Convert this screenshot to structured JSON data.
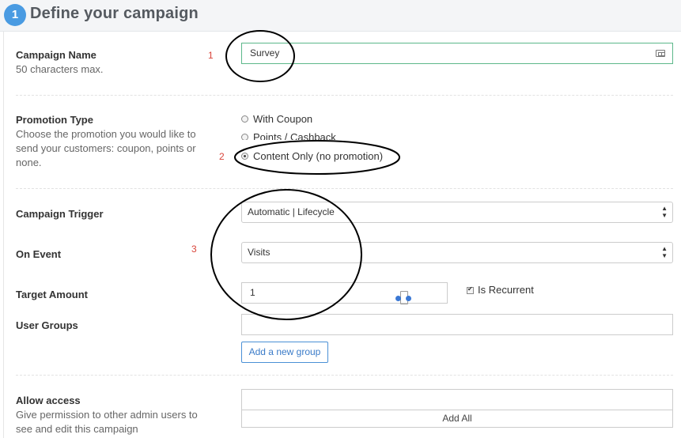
{
  "header": {
    "step_number": "1",
    "title": "Define your campaign"
  },
  "campaign_name": {
    "label": "Campaign Name",
    "hint": "50 characters max.",
    "value": "Survey",
    "icon": "id-card-icon",
    "annotation": "1"
  },
  "promotion_type": {
    "label": "Promotion Type",
    "description_lines": [
      "Choose the promotion you would like to",
      "send your customers: coupon, points or",
      "none."
    ],
    "options": [
      {
        "label": "With Coupon",
        "checked": false
      },
      {
        "label": "Points / Cashback",
        "checked": false
      },
      {
        "label": "Content Only (no promotion)",
        "checked": true
      }
    ],
    "annotation": "2"
  },
  "campaign_trigger": {
    "label": "Campaign Trigger",
    "selected": "Automatic | Lifecycle"
  },
  "on_event": {
    "label": "On Event",
    "selected": "Visits",
    "annotation": "3"
  },
  "target_amount": {
    "label": "Target Amount",
    "value": "1",
    "recurrent_label": "Is Recurrent",
    "recurrent_checked": true
  },
  "user_groups": {
    "label": "User Groups",
    "value": "",
    "add_button": "Add a new group"
  },
  "allow_access": {
    "label": "Allow access",
    "description_lines": [
      "Give permission to other admin users to",
      "see and edit this campaign"
    ],
    "value": "",
    "add_all_button": "Add All"
  },
  "colors": {
    "accent": "#4a9be2",
    "annotation": "#d9443a",
    "active_border": "#5cb88a",
    "link": "#3a7bc8"
  }
}
